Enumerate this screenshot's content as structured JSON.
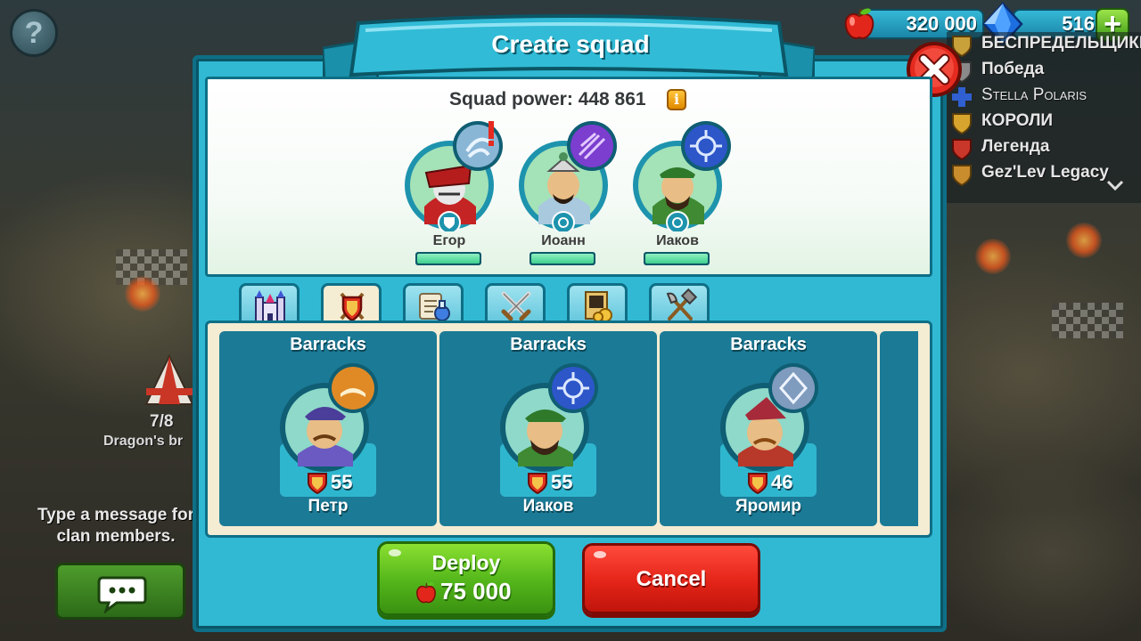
{
  "header": {
    "help_icon": "question-mark-icon",
    "help_label": "?",
    "apples": "320 000",
    "gems": "516",
    "plus_label": "+",
    "colors": {
      "accent": "#31b9d4",
      "confirm": "#52b51a",
      "danger": "#e42418"
    }
  },
  "clans": {
    "items": [
      {
        "name": "БЕСПРЕДЕЛЬЩИКИ"
      },
      {
        "name": "Победа"
      },
      {
        "name": "Stella Polaris"
      },
      {
        "name": "КОРОЛИ"
      },
      {
        "name": "Легенда"
      },
      {
        "name": "Gez'Lev Legacy"
      }
    ]
  },
  "background": {
    "tent_counter": "7/8",
    "dragon_label": "Dragon's br",
    "chat_hint": "Type a message for clan members.",
    "chat_icon": "speech-bubble-icon"
  },
  "dialog": {
    "title": "Create squad",
    "squad_power_label": "Squad power:",
    "squad_power_value": "448 861",
    "info_label": "i",
    "members": [
      {
        "name": "Егор",
        "health": 1.0
      },
      {
        "name": "Иоанн",
        "health": 1.0
      },
      {
        "name": "Иаков",
        "health": 1.0
      }
    ],
    "tabs": [
      {
        "icon": "castle-icon"
      },
      {
        "icon": "shield-icon",
        "active": true
      },
      {
        "icon": "potion-scroll-icon"
      },
      {
        "icon": "crossed-swords-icon"
      },
      {
        "icon": "treasury-icon"
      },
      {
        "icon": "hammer-axe-icon"
      }
    ],
    "troops": [
      {
        "title": "Barracks",
        "level": "55",
        "name": "Петр"
      },
      {
        "title": "Barracks",
        "level": "55",
        "name": "Иаков"
      },
      {
        "title": "Barracks",
        "level": "46",
        "name": "Яромир"
      }
    ],
    "deploy_label": "Deploy",
    "deploy_price": "75 000",
    "cancel_label": "Cancel"
  }
}
